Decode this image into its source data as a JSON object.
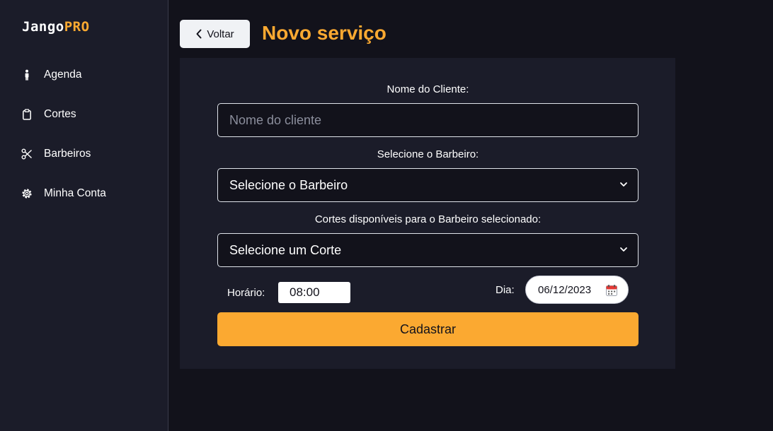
{
  "brand": {
    "name_part1": "Jango",
    "name_part2": "PRO",
    "accent_color": "#fba931"
  },
  "sidebar": {
    "items": [
      {
        "label": "Agenda",
        "icon": "person-icon"
      },
      {
        "label": "Cortes",
        "icon": "clipboard-icon"
      },
      {
        "label": "Barbeiros",
        "icon": "scissors-icon"
      },
      {
        "label": "Minha Conta",
        "icon": "gear-icon"
      }
    ]
  },
  "header": {
    "back_label": "Voltar",
    "title": "Novo serviço"
  },
  "form": {
    "client_label": "Nome do Cliente:",
    "client_placeholder": "Nome do cliente",
    "client_value": "",
    "barber_label": "Selecione o Barbeiro:",
    "barber_selected": "Selecione o Barbeiro",
    "cut_label": "Cortes disponíveis para o Barbeiro selecionado:",
    "cut_selected": "Selecione um Corte",
    "time_label": "Horário:",
    "time_value": "08:00",
    "date_label": "Dia:",
    "date_value": "06/12/2023",
    "submit_label": "Cadastrar"
  }
}
